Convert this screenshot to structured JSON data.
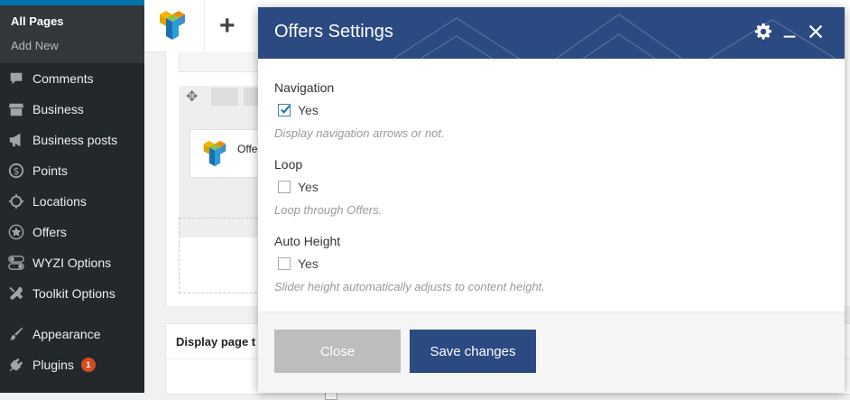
{
  "sidebar": {
    "submenu": [
      {
        "label": "All Pages",
        "current": true
      },
      {
        "label": "Add New",
        "current": false
      }
    ],
    "items": [
      {
        "label": "Comments",
        "icon": "comment-icon"
      },
      {
        "label": "Business",
        "icon": "store-icon"
      },
      {
        "label": "Business posts",
        "icon": "megaphone-icon"
      },
      {
        "label": "Points",
        "icon": "dollar-icon"
      },
      {
        "label": "Locations",
        "icon": "crosshair-icon"
      },
      {
        "label": "Offers",
        "icon": "star-icon"
      },
      {
        "label": "WYZI Options",
        "icon": "toggle-icon"
      },
      {
        "label": "Toolkit Options",
        "icon": "tools-icon"
      },
      {
        "label": "Appearance",
        "icon": "brush-icon"
      },
      {
        "label": "Plugins",
        "icon": "plugin-icon",
        "badge": "1"
      }
    ]
  },
  "toolbar": {
    "add_icon": "+"
  },
  "canvas": {
    "element_label": "Offe",
    "display_title": "Display page t"
  },
  "modal": {
    "title": "Offers Settings",
    "settings": [
      {
        "title": "Navigation",
        "option": "Yes",
        "checked": true,
        "description": "Display navigation arrows or not."
      },
      {
        "title": "Loop",
        "option": "Yes",
        "checked": false,
        "description": "Loop through Offers."
      },
      {
        "title": "Auto Height",
        "option": "Yes",
        "checked": false,
        "description": "Slider height automatically adjusts to content height."
      }
    ],
    "close_label": "Close",
    "save_label": "Save changes"
  },
  "colors": {
    "sidebar_bg": "#23282d",
    "modal_header": "#2b4a81",
    "save_button": "#2b4a81",
    "close_button": "#bdbdbd",
    "badge": "#d54e21"
  }
}
